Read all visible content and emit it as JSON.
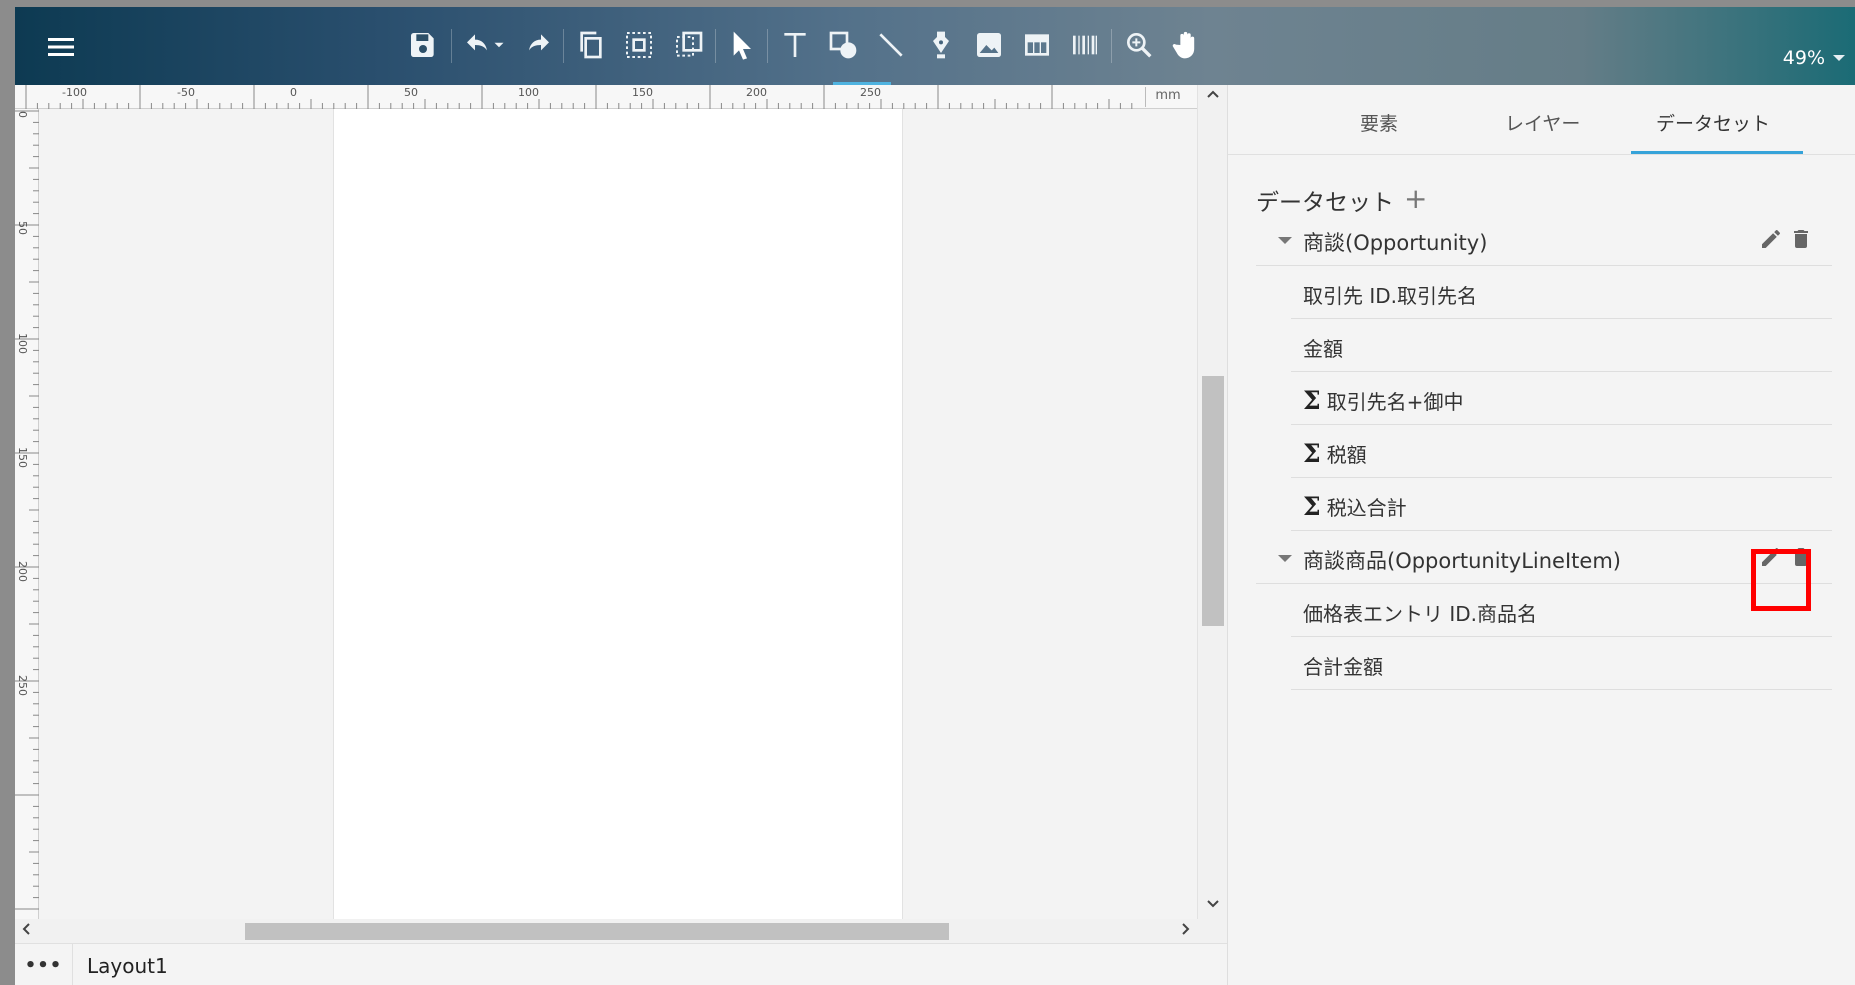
{
  "toolbar": {
    "icons": [
      "menu-icon",
      "save-icon",
      "undo-icon",
      "undo-dropdown-icon",
      "redo-icon",
      "copy-icon",
      "select-all-icon",
      "group-icon",
      "pointer-icon",
      "text-tool-icon",
      "shape-tool-icon",
      "line-tool-icon",
      "pen-tool-icon",
      "image-tool-icon",
      "table-tool-icon",
      "barcode-tool-icon",
      "zoom-tool-icon",
      "pan-tool-icon"
    ],
    "zoom": "49%",
    "colors": {
      "gradient_start": "#0d3a52",
      "gradient_end": "#1b6b75",
      "active_underline": "#4fb3e0"
    }
  },
  "ruler": {
    "unit": "mm",
    "h_labels": [
      "-100",
      "-50",
      "0",
      "50",
      "100",
      "150",
      "200",
      "250"
    ],
    "v_labels": [
      "0",
      "50",
      "100",
      "150",
      "200",
      "250"
    ]
  },
  "bottom_bar": {
    "more_label": "•••",
    "layout_tab": "Layout1"
  },
  "panel": {
    "tabs": [
      {
        "label": "要素"
      },
      {
        "label": "レイヤー"
      },
      {
        "label": "データセット",
        "active": true
      }
    ],
    "dataset_header": "データセット",
    "add_symbol": "+",
    "groups": [
      {
        "name": "商談(Opportunity)",
        "fields": [
          {
            "label": "取引先 ID.取引先名",
            "formula": false
          },
          {
            "label": "金額",
            "formula": false
          },
          {
            "label": "取引先名+御中",
            "formula": true
          },
          {
            "label": "税額",
            "formula": true
          },
          {
            "label": "税込合計",
            "formula": true
          }
        ]
      },
      {
        "name": "商談商品(OpportunityLineItem)",
        "fields": [
          {
            "label": "価格表エントリ ID.商品名",
            "formula": false
          },
          {
            "label": "合計金額",
            "formula": false
          }
        ]
      }
    ],
    "sigma": "Σ",
    "colors": {
      "active_tab": "#36a3d9",
      "highlight": "#ff0000"
    }
  }
}
